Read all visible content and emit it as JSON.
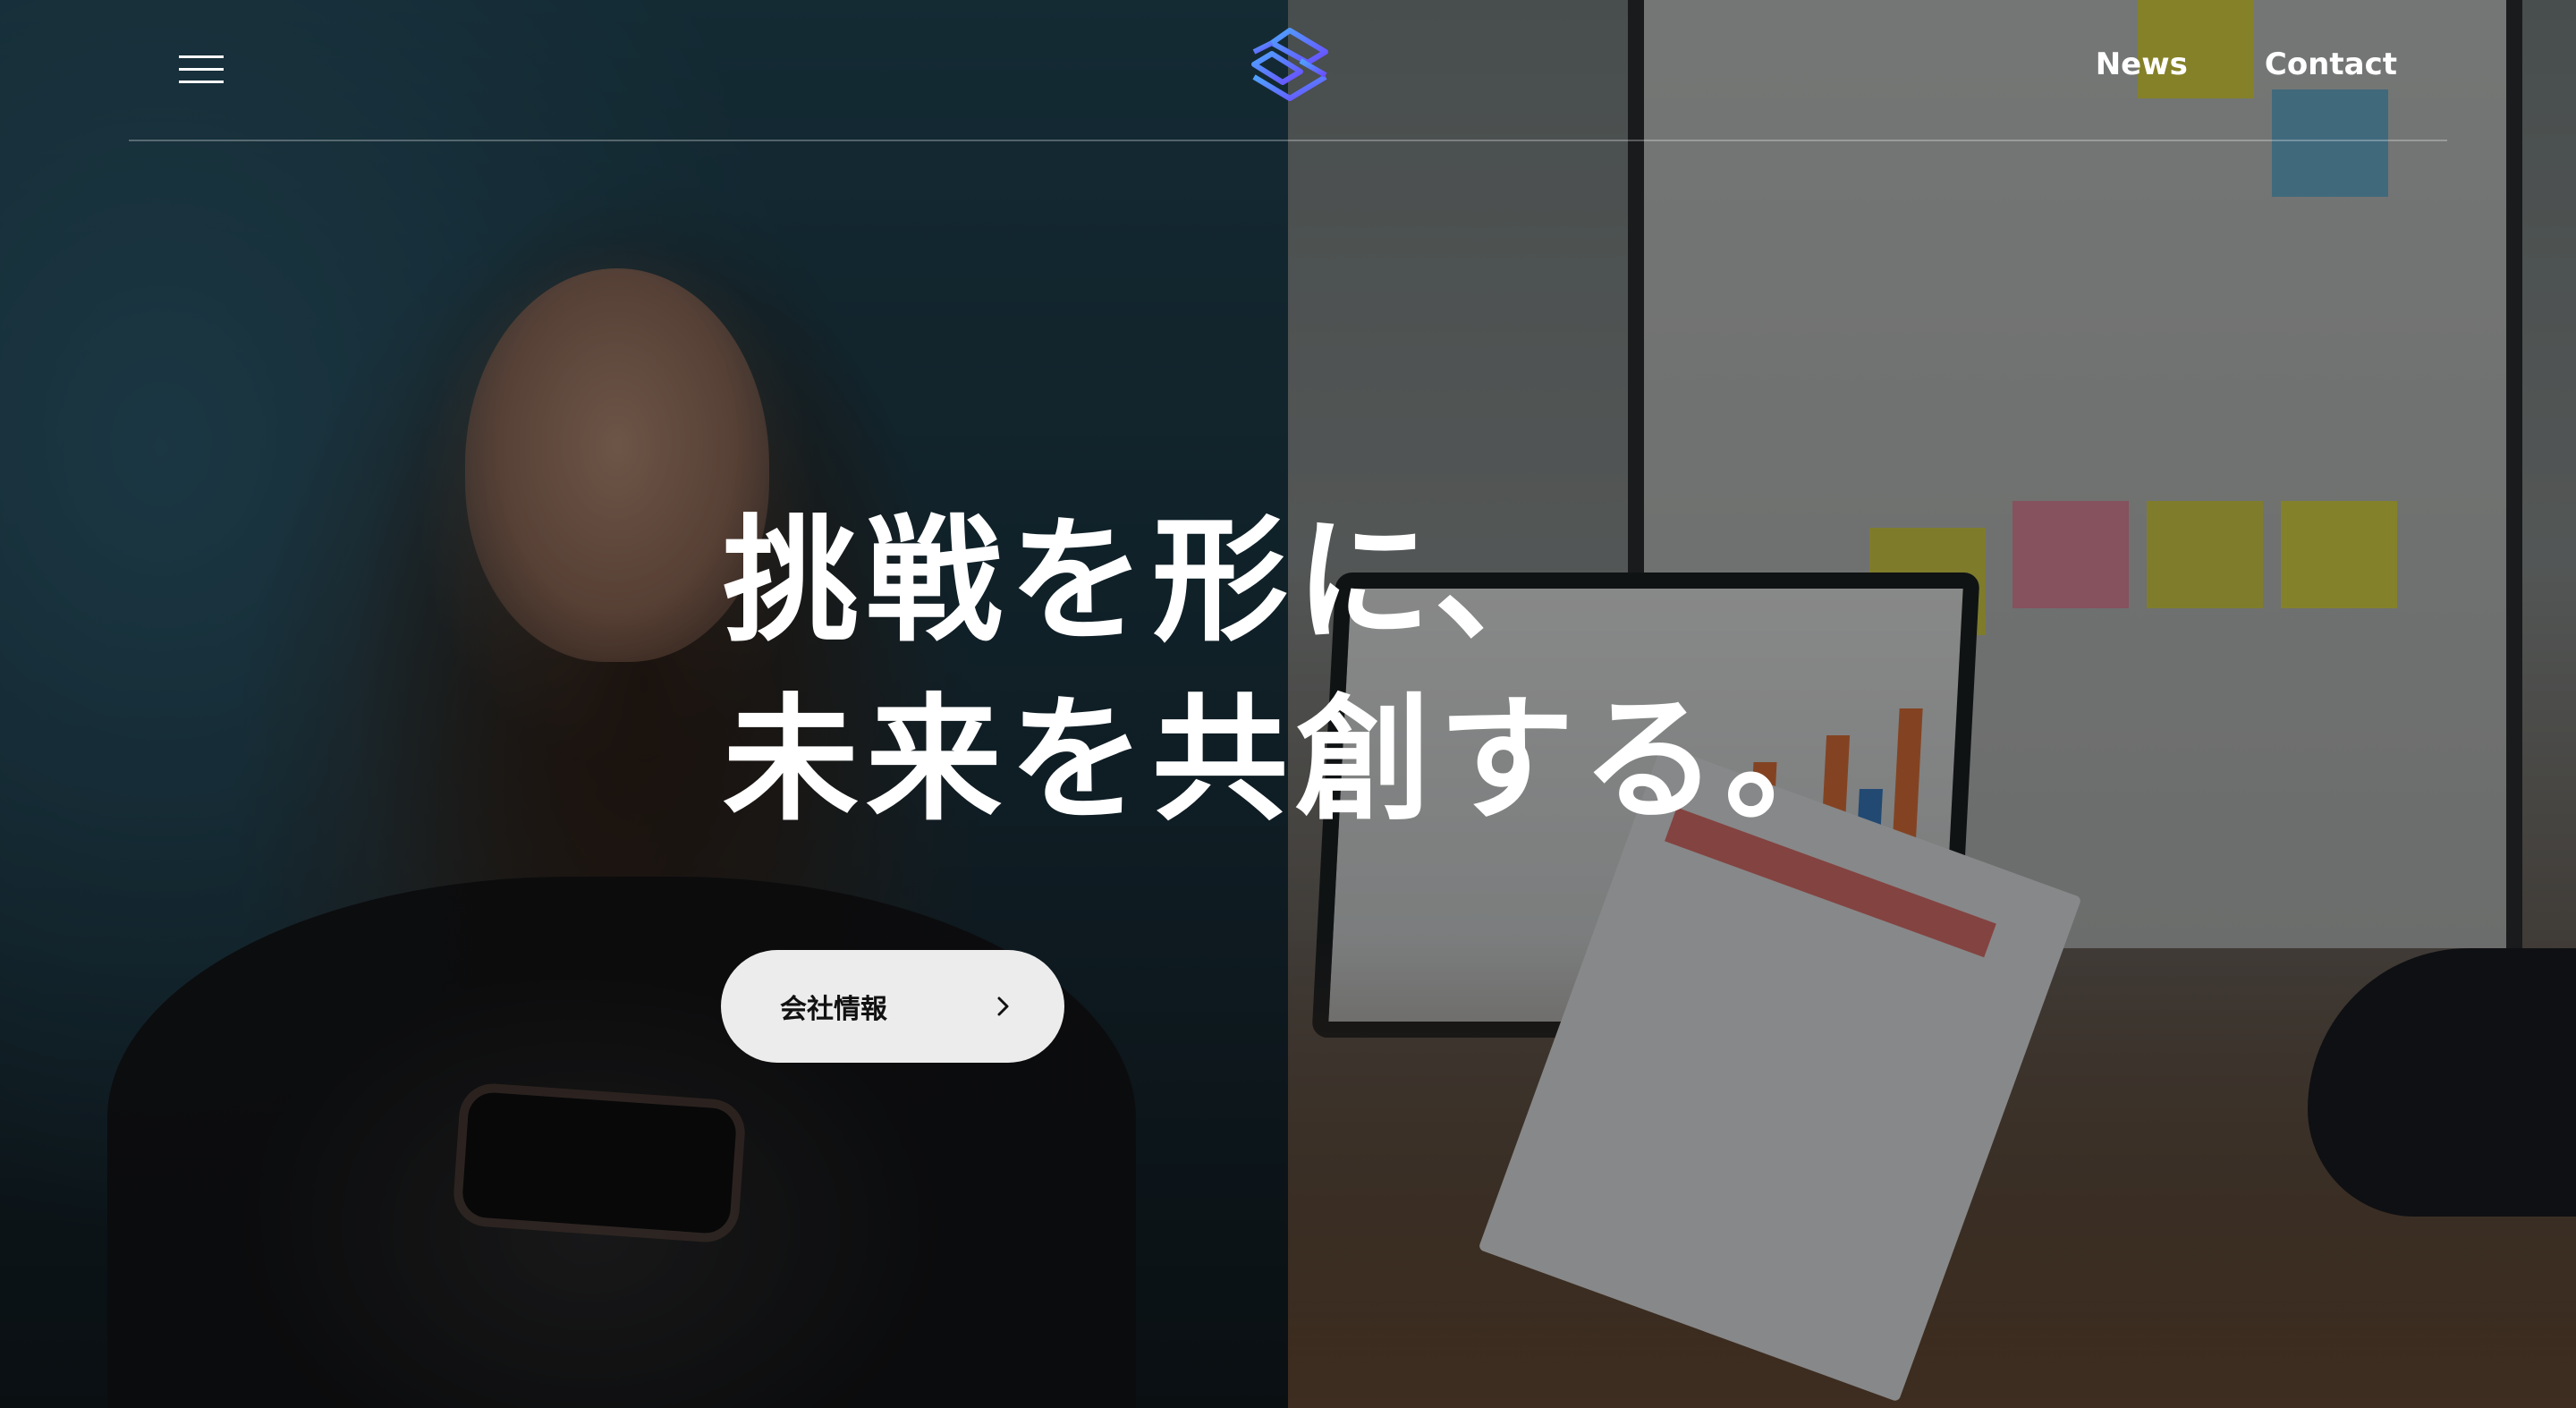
{
  "header": {
    "nav": [
      {
        "label": "News"
      },
      {
        "label": "Contact"
      }
    ]
  },
  "hero": {
    "headline_line1": "挑戦を形に、",
    "headline_line2": "未来を共創する。",
    "cta_label": "会社情報"
  },
  "icons": {
    "menu": "hamburger-menu-icon",
    "logo": "layered-stack-logo",
    "cta_arrow": "chevron-right-icon"
  },
  "colors": {
    "text": "#ffffff",
    "button_bg": "#ececec",
    "button_text": "#111111",
    "logo_gradient_start": "#4fa3ff",
    "logo_gradient_end": "#6a4dff"
  }
}
